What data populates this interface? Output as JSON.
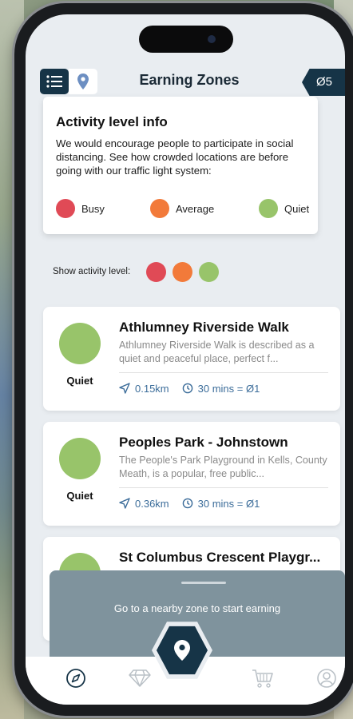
{
  "colors": {
    "navy": "#163447",
    "busy": "#e04a56",
    "average": "#f27a3a",
    "quiet": "#98c46a",
    "link": "#3c6d9a",
    "sheet": "#7f939d"
  },
  "header": {
    "title": "Earning Zones",
    "coin_balance": "Ø5",
    "menu_icon": "list-icon",
    "map_icon": "map-pin-icon"
  },
  "info": {
    "title": "Activity level info",
    "text": "We would encourage people to participate in social distancing. See how crowded locations are before going with our traffic light system:",
    "legend": [
      {
        "label": "Busy"
      },
      {
        "label": "Average"
      },
      {
        "label": "Quiet"
      }
    ]
  },
  "activity": {
    "label": "Show activity level:"
  },
  "zones": [
    {
      "name": "Athlumney Riverside Walk",
      "description": "Athlumney Riverside Walk is described as a quiet and peaceful place, perfect f...",
      "level": "Quiet",
      "distance": "0.15km",
      "reward": "30 mins = Ø1"
    },
    {
      "name": "Peoples Park - Johnstown",
      "description": "The People's Park Playground in Kells, County Meath, is a popular, free public...",
      "level": "Quiet",
      "distance": "0.36km",
      "reward": "30 mins = Ø1"
    },
    {
      "name": "St Columbus Crescent Playgr...",
      "description": "",
      "level": "Quiet",
      "distance": "",
      "reward": ""
    }
  ],
  "sheet": {
    "message": "Go to a nearby zone to start earning"
  },
  "nav": {
    "items": [
      "compass-icon",
      "diamond-icon",
      "map-pin-icon",
      "cart-icon",
      "user-icon"
    ]
  }
}
